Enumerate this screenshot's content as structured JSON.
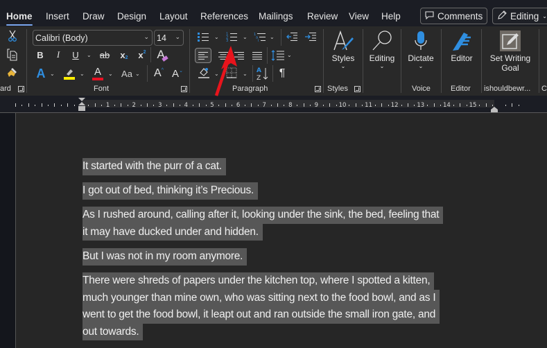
{
  "tabs": [
    {
      "label": "Home",
      "active": true
    },
    {
      "label": "Insert"
    },
    {
      "label": "Draw"
    },
    {
      "label": "Design"
    },
    {
      "label": "Layout"
    },
    {
      "label": "References"
    },
    {
      "label": "Mailings"
    },
    {
      "label": "Review"
    },
    {
      "label": "View"
    },
    {
      "label": "Help"
    }
  ],
  "top_buttons": {
    "comments": {
      "label": "Comments",
      "icon": "comment-icon"
    },
    "editing": {
      "label": "Editing",
      "icon": "pencil-icon"
    }
  },
  "ribbon": {
    "clipboard": {
      "label": "ard",
      "icons": [
        "cut-icon",
        "copy-icon",
        "format-painter-icon"
      ]
    },
    "font": {
      "label": "Font",
      "font_name": "Calibri (Body)",
      "font_size": "14",
      "buttons": {
        "bold": "B",
        "italic": "I",
        "underline": "U",
        "strikethrough": "ab",
        "subscript": "x",
        "superscript": "x",
        "case": "Aa",
        "grow": "A",
        "shrink": "A",
        "text_effects": "A",
        "font_color": "A",
        "clear_format": "A"
      },
      "colors": {
        "highlight": "#ffee00",
        "font_color": "#e81123",
        "text_effects": "#2f8ee0"
      }
    },
    "paragraph": {
      "label": "Paragraph",
      "icons": [
        "bullets-icon",
        "numbering-icon",
        "multilevel-list-icon",
        "decrease-indent-icon",
        "increase-indent-icon",
        "align-left-icon",
        "align-center-icon",
        "align-right-icon",
        "justify-icon",
        "line-spacing-icon",
        "shading-icon",
        "borders-icon",
        "sort-icon",
        "show-formatting-icon"
      ],
      "sort_label": "A Z",
      "pilcrow": "¶"
    },
    "styles": {
      "button_label": "Styles",
      "group_label": "Styles"
    },
    "editing": {
      "button_label": "Editing"
    },
    "voice": {
      "button_label": "Dictate",
      "group_label": "Voice"
    },
    "editor": {
      "button_label": "Editor",
      "group_label": "Editor"
    },
    "writing_goal": {
      "button_line1": "Set Writing",
      "button_line2": "Goal",
      "group_label": "ishouldbewr..."
    }
  },
  "ruler": {
    "ticks": [
      "1",
      "2",
      "3",
      "4",
      "5",
      "6",
      "7",
      "8",
      "9",
      "10",
      "11",
      "12",
      "13",
      "14",
      "15"
    ]
  },
  "document": {
    "paragraphs": [
      {
        "lines": [
          "It started with the purr of a cat."
        ]
      },
      {
        "lines": [
          "I got out of bed, thinking it’s Precious."
        ]
      },
      {
        "lines": [
          "As I rushed around, calling after it, looking under the sink, the bed, feeling that",
          "it may have ducked under and hidden."
        ]
      },
      {
        "lines": [
          "But I was not in my room anymore."
        ]
      },
      {
        "lines": [
          "There were shreds of papers under the kitchen top, where I spotted a kitten,",
          "much younger than mine own, who was sitting next to the food bowl, and as I",
          "went to get the food bowl, it leapt out and ran outside the small iron gate, and",
          "out towards."
        ]
      }
    ],
    "selection_color": "#575757"
  },
  "annotation": {
    "arrow_color": "#e8141c",
    "target": "numbering-button"
  }
}
